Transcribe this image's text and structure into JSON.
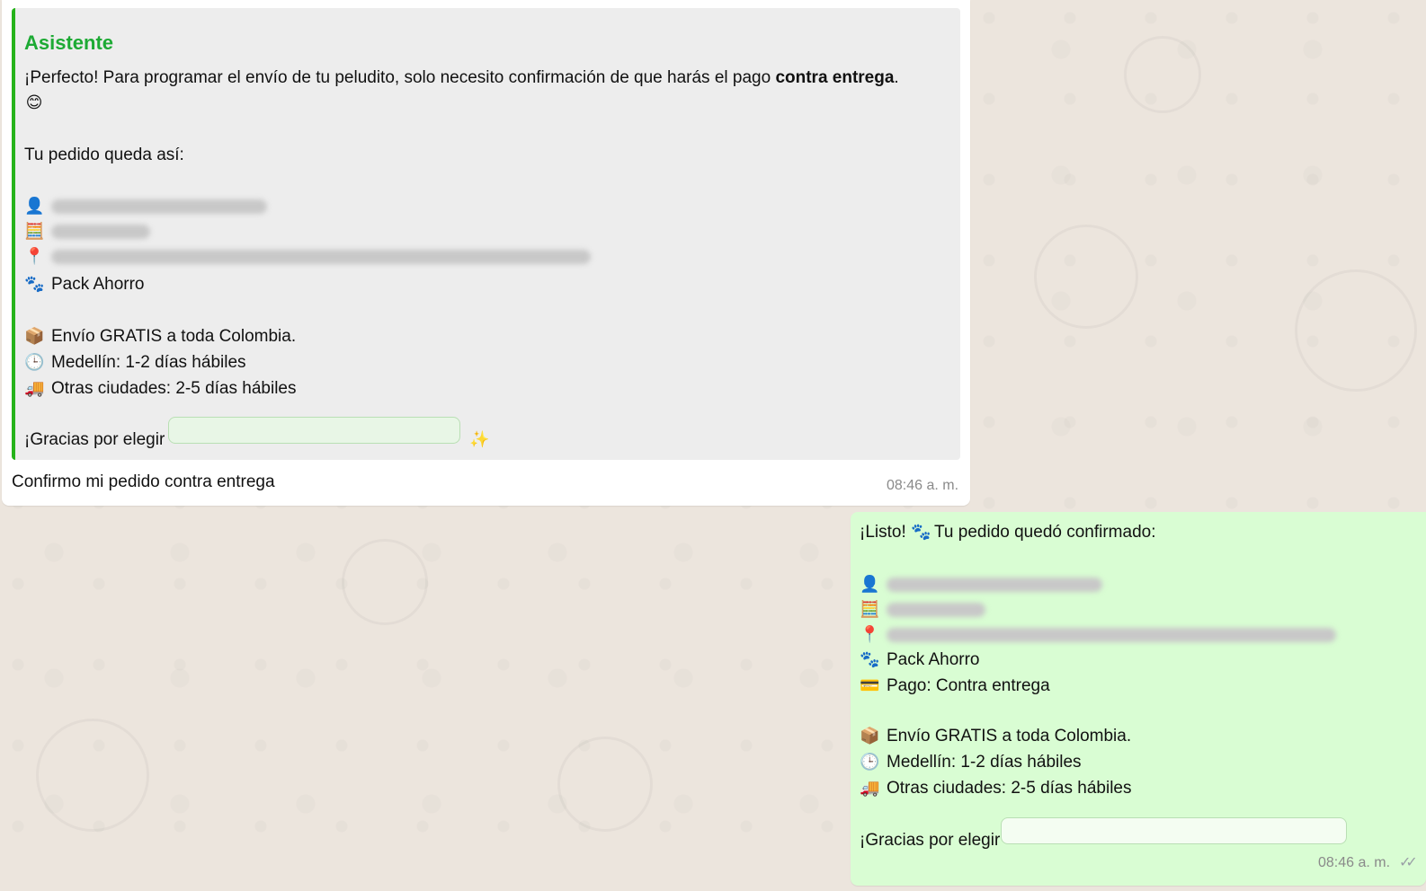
{
  "incoming": {
    "quote": {
      "author": "Asistente",
      "intro_before": "¡Perfecto! Para programar el envío de tu peludito, solo necesito confirmación de que harás el pago ",
      "intro_bold": "contra entrega",
      "intro_after": ".",
      "intro_emoji": "😊",
      "summary_heading": "Tu pedido queda así:",
      "name_icon": "👤",
      "phone_icon": "🧮",
      "address_icon": "📍",
      "product_icon": "🐾",
      "product": "Pack Ahorro",
      "shipping_icon": "📦",
      "shipping": "Envío GRATIS a toda Colombia.",
      "medellin_icon": "🕒",
      "medellin": "Medellín: 1-2 días hábiles",
      "others_icon": "🚚",
      "others": "Otras ciudades: 2-5 días hábiles",
      "thanks": "¡Gracias por elegir",
      "thanks_emoji": "✨"
    },
    "reply": "Confirmo  mi pedido  contra entrega",
    "time": "08:46 a. m."
  },
  "outgoing": {
    "listo": "¡Listo!",
    "paw": "🐾",
    "confirmed": "Tu pedido quedó confirmado:",
    "name_icon": "👤",
    "phone_icon": "🧮",
    "address_icon": "📍",
    "product_icon": "🐾",
    "product": "Pack Ahorro",
    "payment_icon": "💳",
    "payment": "Pago: Contra entrega",
    "shipping_icon": "📦",
    "shipping": "Envío GRATIS a toda Colombia.",
    "medellin_icon": "🕒",
    "medellin": "Medellín: 1-2 días hábiles",
    "others_icon": "🚚",
    "others": "Otras ciudades: 2-5 días hábiles",
    "thanks": "¡Gracias por elegir",
    "time": "08:46 a. m.",
    "ticks": "✓✓"
  }
}
